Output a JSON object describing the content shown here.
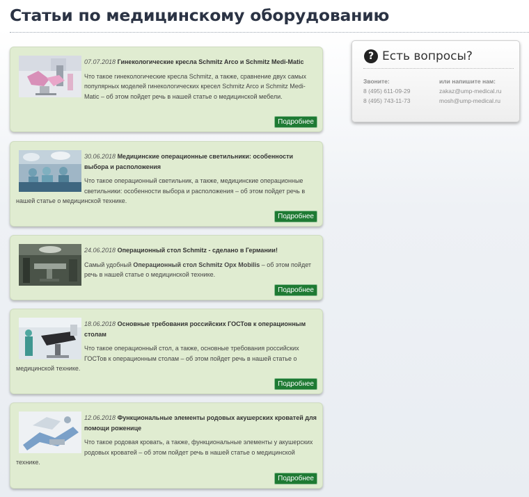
{
  "page": {
    "title": "Статьи по медицинскому оборудованию"
  },
  "articles": [
    {
      "date": "07.07.2018",
      "title": "Гинекологические кресла Schmitz Arco и Schmitz Medi-Matic",
      "text_before": "Что такое гинекологические кресла Schmitz, а также, сравнение двух самых популярных моделей гинекологических кресел Schmitz Arco и Schmitz Medi-Matic – об этом пойдет речь в нашей статье о медицинской мебели.",
      "text_bold": "",
      "text_after": "",
      "more": "Подробнее",
      "image": "gynecological-chair-photo"
    },
    {
      "date": "30.06.2018",
      "title": "Медицинские операционные светильники: особенности выбора и расположения",
      "text_before": "Что такое операционный светильник, а также, медицинские операционные светильники: особенности выбора и расположения – об этом пойдет речь в нашей статье о медицинской технике.",
      "text_bold": "",
      "text_after": "",
      "more": "Подробнее",
      "image": "surgical-lights-photo"
    },
    {
      "date": "24.06.2018",
      "title": "Операционный стол Schmitz - сделано в Германии!",
      "text_before": "Самый удобный ",
      "text_bold": "Операционный стол Schmitz Opx Mobilis",
      "text_after": " – об этом пойдет речь в нашей статье о медицинской технике.",
      "more": "Подробнее",
      "image": "operating-table-photo"
    },
    {
      "date": "18.06.2018",
      "title": "Основные требования российских ГОСТов к операционным столам",
      "text_before": "Что такое операционный стол, а также, основные требования российских ГОСТов к операционным столам – об этом пойдет речь в нашей статье о медицинской технике.",
      "text_bold": "",
      "text_after": "",
      "more": "Подробнее",
      "image": "operating-room-photo"
    },
    {
      "date": "12.06.2018",
      "title": "Функциональные элементы родовых акушерских кроватей для помощи роженице",
      "text_before": "Что такое родовая кровать, а также, функциональные элементы у акушерских родовых кроватей – об этом пойдет речь в нашей статье о медицинской технике.",
      "text_bold": "",
      "text_after": "",
      "more": "Подробнее",
      "image": "birthing-bed-photo"
    }
  ],
  "questions": {
    "icon": "question-circle-icon",
    "title": "Есть вопросы?",
    "call_label": "Звоните:",
    "phones": [
      "8 (495) 611-09-29",
      "8 (495) 743-11-73"
    ],
    "write_label": "или напишите нам:",
    "emails": [
      "zakaz@ump-medical.ru",
      "mosh@ump-medical.ru"
    ]
  }
}
